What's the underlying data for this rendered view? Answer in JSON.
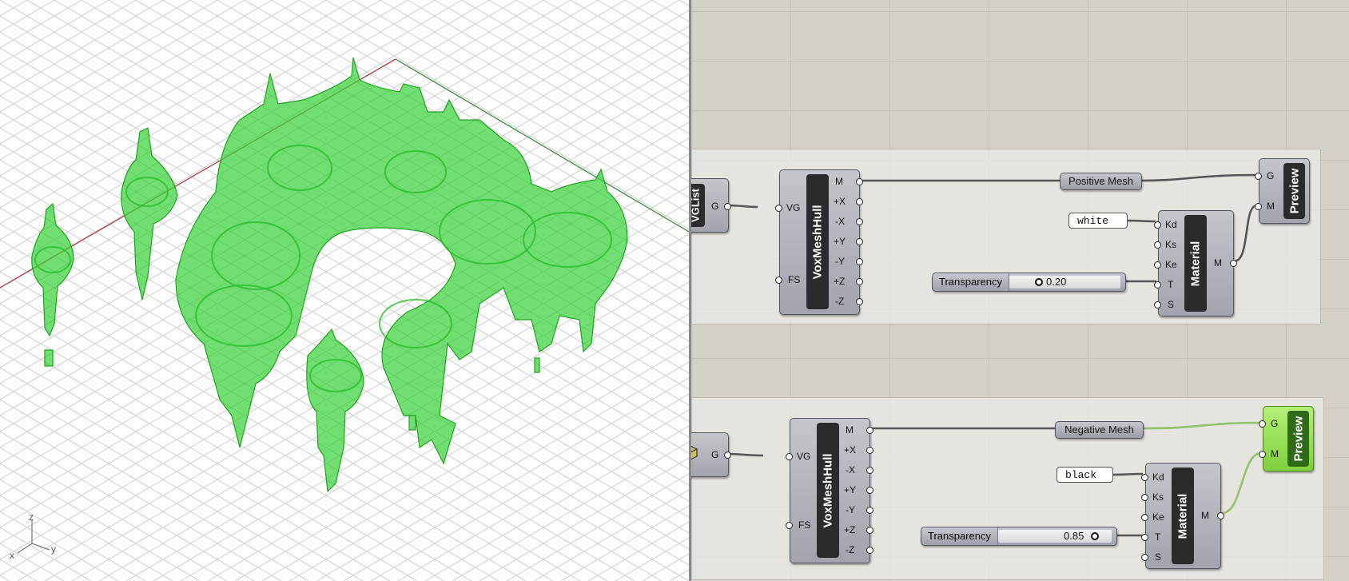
{
  "viewport": {
    "axis_labels": {
      "x": "x",
      "y": "y",
      "z": "z"
    },
    "mesh_color": "#3dd43d",
    "edge_color": "#1fae1f"
  },
  "canvas": {
    "wire_color": "#555555",
    "preview_wire_color": "#8fc46a",
    "groups": [
      {
        "source": {
          "label": "VGList",
          "output": "G"
        },
        "hull": {
          "title": "VoxMeshHull",
          "inputs": [
            "VG",
            "FS"
          ],
          "outputs": [
            "M",
            "+X",
            "-X",
            "+Y",
            "-Y",
            "+Z",
            "-Z"
          ]
        },
        "relay": "Positive Mesh",
        "color_panel": "white",
        "slider": {
          "label": "Transparency",
          "value": "0.20",
          "fraction": 0.2
        },
        "material": {
          "title": "Material",
          "inputs": [
            "Kd",
            "Ks",
            "Ke",
            "T",
            "S"
          ],
          "output": "M"
        },
        "preview": {
          "title": "Preview",
          "inputs": [
            "G",
            "M"
          ],
          "active": false
        }
      },
      {
        "source": {
          "label": "",
          "output": "G"
        },
        "hull": {
          "title": "VoxMeshHull",
          "inputs": [
            "VG",
            "FS"
          ],
          "outputs": [
            "M",
            "+X",
            "-X",
            "+Y",
            "-Y",
            "+Z",
            "-Z"
          ]
        },
        "relay": "Negative Mesh",
        "color_panel": "black",
        "slider": {
          "label": "Transparency",
          "value": "0.85",
          "fraction": 0.85
        },
        "material": {
          "title": "Material",
          "inputs": [
            "Kd",
            "Ks",
            "Ke",
            "T",
            "S"
          ],
          "output": "M"
        },
        "preview": {
          "title": "Preview",
          "inputs": [
            "G",
            "M"
          ],
          "active": true
        }
      }
    ]
  }
}
